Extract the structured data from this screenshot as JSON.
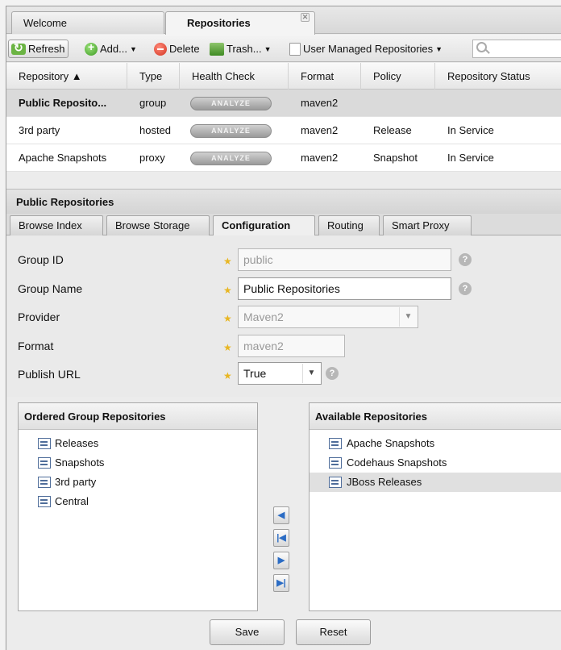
{
  "tabs": [
    {
      "label": "Welcome"
    },
    {
      "label": "Repositories",
      "close": "✕"
    }
  ],
  "toolbar": {
    "refresh": "Refresh",
    "add": "Add...",
    "delete": "Delete",
    "trash": "Trash...",
    "user_managed": "User Managed Repositories",
    "search_placeholder": ""
  },
  "grid": {
    "columns": [
      "Repository ▲",
      "Type",
      "Health Check",
      "Format",
      "Policy",
      "Repository Status"
    ],
    "analyze_label": "ANALYZE",
    "rows": [
      {
        "repository": "Public Reposito...",
        "type": "group",
        "format": "maven2",
        "policy": "",
        "status": ""
      },
      {
        "repository": "3rd party",
        "type": "hosted",
        "format": "maven2",
        "policy": "Release",
        "status": "In Service"
      },
      {
        "repository": "Apache Snapshots",
        "type": "proxy",
        "format": "maven2",
        "policy": "Snapshot",
        "status": "In Service"
      }
    ]
  },
  "detail": {
    "title": "Public Repositories",
    "subtabs": [
      "Browse Index",
      "Browse Storage",
      "Configuration",
      "Routing",
      "Smart Proxy"
    ]
  },
  "form": {
    "group_id_label": "Group ID",
    "group_id_value": "public",
    "group_name_label": "Group Name",
    "group_name_value": "Public Repositories",
    "provider_label": "Provider",
    "provider_value": "Maven2",
    "format_label": "Format",
    "format_value": "maven2",
    "publish_url_label": "Publish URL",
    "publish_url_value": "True",
    "required_mark": "★",
    "help_mark": "?"
  },
  "ordered": {
    "title": "Ordered Group Repositories",
    "items": [
      "Releases",
      "Snapshots",
      "3rd party",
      "Central"
    ]
  },
  "available": {
    "title": "Available Repositories",
    "items": [
      "Apache Snapshots",
      "Codehaus Snapshots",
      "JBoss Releases"
    ]
  },
  "move_buttons": [
    "◀",
    "|◀",
    "▶",
    "▶|"
  ],
  "buttons": {
    "save": "Save",
    "reset": "Reset"
  },
  "colors": {
    "accent": "#2b6cc4",
    "star": "#e8b622",
    "selected_row": "#dadada"
  }
}
